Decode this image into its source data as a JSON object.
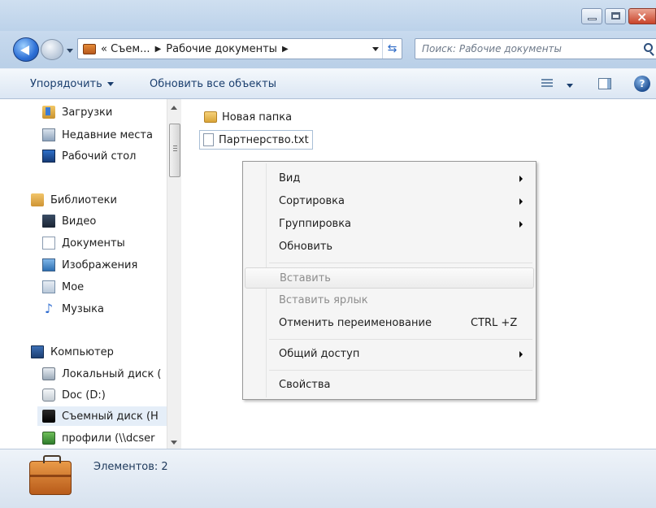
{
  "window": {
    "controls": [
      "minimize",
      "maximize",
      "close"
    ]
  },
  "address": {
    "crumbs": [
      "« Съем...",
      "Рабочие документы"
    ],
    "search_placeholder": "Поиск: Рабочие документы"
  },
  "toolbar": {
    "organize_label": "Упорядочить",
    "refresh_all_label": "Обновить все объекты"
  },
  "sidebar": {
    "items": [
      {
        "label": "Загрузки",
        "icon": "downloads-icon"
      },
      {
        "label": "Недавние места",
        "icon": "recent-places-icon"
      },
      {
        "label": "Рабочий стол",
        "icon": "desktop-icon"
      },
      {
        "label": "Библиотеки",
        "icon": "libraries-icon"
      },
      {
        "label": "Видео",
        "icon": "video-icon"
      },
      {
        "label": "Документы",
        "icon": "documents-icon"
      },
      {
        "label": "Изображения",
        "icon": "images-icon"
      },
      {
        "label": "Мое",
        "icon": "library-icon"
      },
      {
        "label": "Музыка",
        "icon": "music-icon"
      },
      {
        "label": "Компьютер",
        "icon": "computer-icon"
      },
      {
        "label": "Локальный диск (",
        "icon": "local-disk-icon"
      },
      {
        "label": "Doc (D:)",
        "icon": "dvd-drive-icon"
      },
      {
        "label": "Съемный диск (H",
        "icon": "removable-disk-icon"
      },
      {
        "label": "профили (\\\\dcser",
        "icon": "network-drive-icon"
      }
    ]
  },
  "files": [
    {
      "name": "Новая папка",
      "type": "folder"
    },
    {
      "name": "Партнерство.txt",
      "type": "text-file"
    }
  ],
  "context_menu": {
    "items": [
      {
        "label": "Вид",
        "submenu": true
      },
      {
        "label": "Сортировка",
        "submenu": true
      },
      {
        "label": "Группировка",
        "submenu": true
      },
      {
        "label": "Обновить"
      },
      {
        "label": "Вставить",
        "disabled": true
      },
      {
        "label": "Вставить ярлык",
        "disabled": true
      },
      {
        "label": "Отменить переименование",
        "shortcut": "CTRL +Z"
      },
      {
        "label": "Общий доступ",
        "submenu": true
      },
      {
        "label": "Свойства"
      }
    ]
  },
  "status": {
    "items_count": "Элементов: 2"
  }
}
